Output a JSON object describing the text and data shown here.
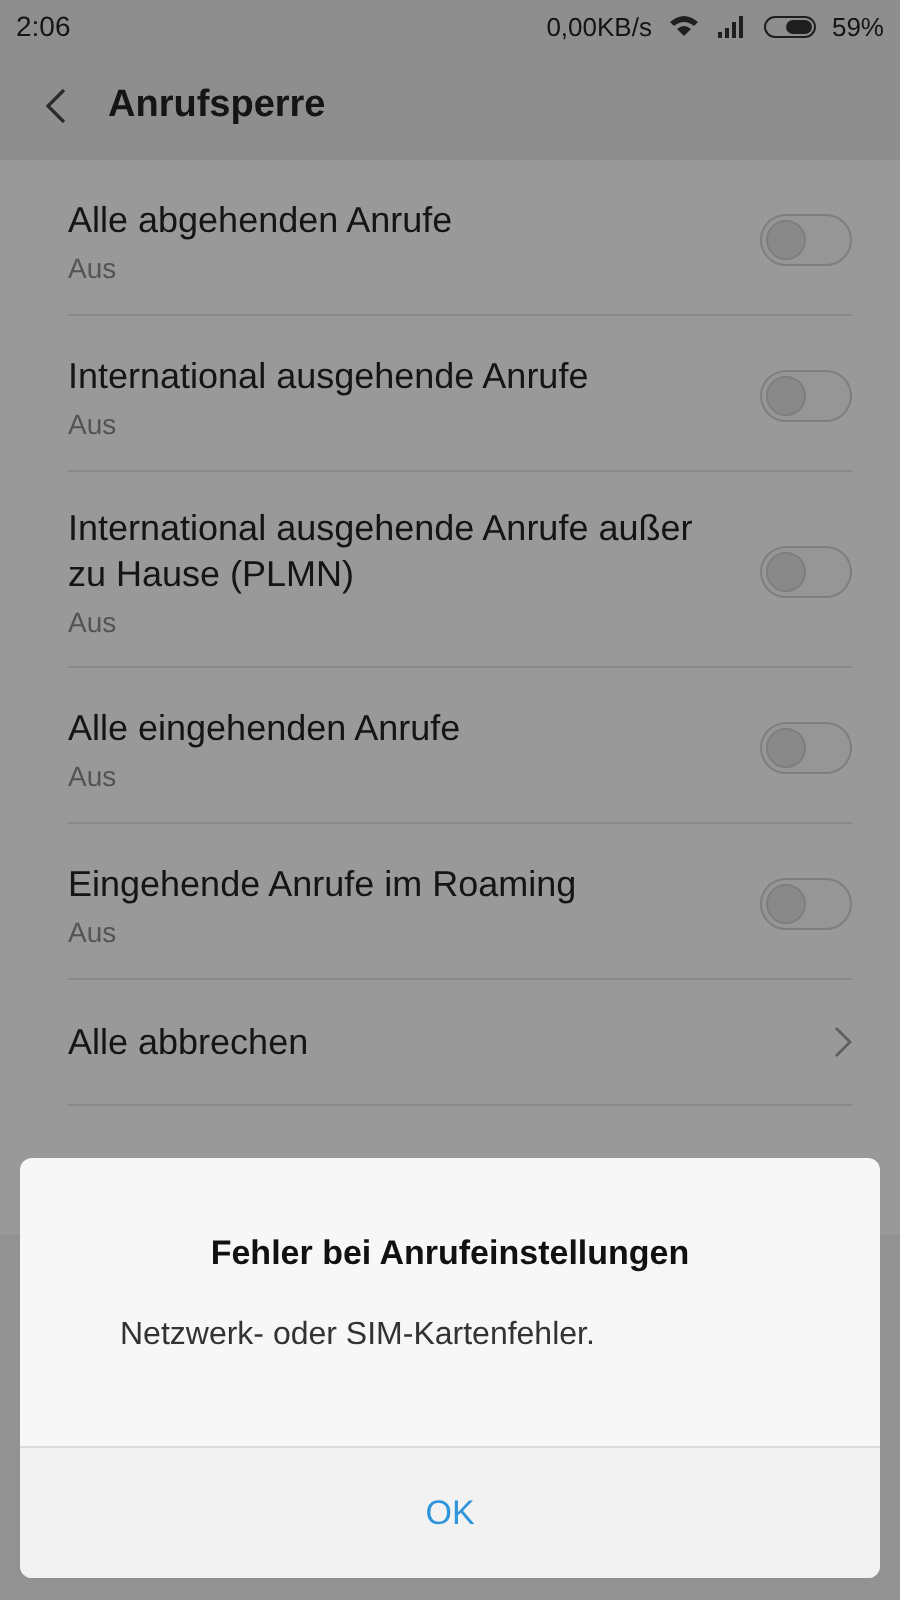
{
  "status_bar": {
    "time": "2:06",
    "network_speed": "0,00KB/s",
    "battery": "59%"
  },
  "header": {
    "title": "Anrufsperre"
  },
  "items": [
    {
      "kind": "toggle",
      "title": "Alle abgehenden Anrufe",
      "summary": "Aus",
      "on": false
    },
    {
      "kind": "toggle",
      "title": "International ausgehende Anrufe",
      "summary": "Aus",
      "on": false
    },
    {
      "kind": "toggle",
      "title": "International ausgehende Anrufe außer zu Hause (PLMN)",
      "summary": "Aus",
      "on": false
    },
    {
      "kind": "toggle",
      "title": "Alle eingehenden Anrufe",
      "summary": "Aus",
      "on": false
    },
    {
      "kind": "toggle",
      "title": "Eingehende Anrufe im Roaming",
      "summary": "Aus",
      "on": false
    },
    {
      "kind": "link",
      "title": "Alle abbrechen"
    }
  ],
  "dialog": {
    "title": "Fehler bei Anrufeinstellungen",
    "message": "Netzwerk- oder SIM-Kartenfehler.",
    "buttons": [
      "OK"
    ]
  }
}
